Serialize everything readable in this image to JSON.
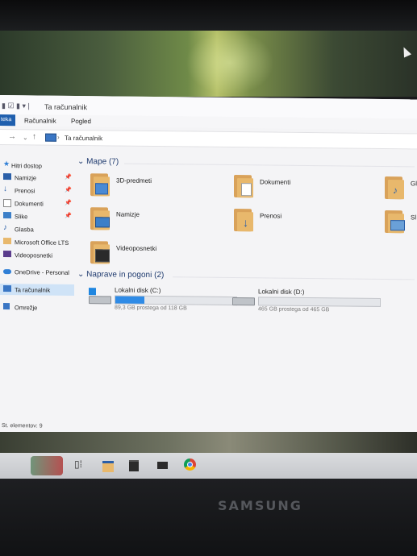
{
  "window": {
    "title": "Ta računalnik",
    "status": "St. elementov: 9"
  },
  "ribbon": {
    "file_tab": "teka",
    "tabs": [
      "Računalnik",
      "Pogled"
    ]
  },
  "address": {
    "path": "Ta računalnik"
  },
  "navpane": {
    "items": [
      {
        "label": "Hitri dostop",
        "icon": "star-icon",
        "pinned": false,
        "selected": false
      },
      {
        "label": "Namizje",
        "icon": "desktop-icon",
        "pinned": true,
        "selected": false
      },
      {
        "label": "Prenosi",
        "icon": "download-icon",
        "pinned": true,
        "selected": false
      },
      {
        "label": "Dokumenti",
        "icon": "document-icon",
        "pinned": true,
        "selected": false
      },
      {
        "label": "Slike",
        "icon": "pictures-icon",
        "pinned": true,
        "selected": false
      },
      {
        "label": "Glasba",
        "icon": "music-icon",
        "pinned": false,
        "selected": false
      },
      {
        "label": "Microsoft Office LTS",
        "icon": "folder-icon",
        "pinned": false,
        "selected": false
      },
      {
        "label": "Videoposnetki",
        "icon": "video-icon",
        "pinned": false,
        "selected": false
      },
      {
        "label": "OneDrive - Personal",
        "icon": "cloud-icon",
        "pinned": false,
        "selected": false
      },
      {
        "label": "Ta računalnik",
        "icon": "computer-icon",
        "pinned": false,
        "selected": true
      },
      {
        "label": "Omrežje",
        "icon": "network-icon",
        "pinned": false,
        "selected": false
      }
    ]
  },
  "folders": {
    "header": "Mape (7)",
    "items": [
      {
        "label": "3D-predmeti",
        "icon": "3d-objects-icon"
      },
      {
        "label": "Dokumenti",
        "icon": "documents-folder-icon"
      },
      {
        "label": "Gl",
        "icon": "music-folder-icon"
      },
      {
        "label": "Namizje",
        "icon": "desktop-folder-icon"
      },
      {
        "label": "Prenosi",
        "icon": "downloads-folder-icon"
      },
      {
        "label": "Sl",
        "icon": "pictures-folder-icon"
      },
      {
        "label": "Videoposnetki",
        "icon": "videos-folder-icon"
      }
    ]
  },
  "drives": {
    "header": "Naprave in pogoni (2)",
    "items": [
      {
        "label": "Lokalni disk (C:)",
        "free": "89,3 GB prostega od 118 GB",
        "used_fraction": 0.24,
        "icon": "windows-drive-icon"
      },
      {
        "label": "Lokalni disk (D:)",
        "free": "465 GB prostega od 465 GB",
        "used_fraction": 0.0,
        "icon": "hard-drive-icon"
      }
    ]
  },
  "taskbar": {
    "icons": [
      "task-view-icon",
      "file-explorer-icon",
      "store-icon",
      "mail-icon",
      "chrome-icon"
    ]
  },
  "device": {
    "brand": "SAMSUNG"
  },
  "colors": {
    "accent": "#1f5fae",
    "drive_fill": "#2f8be6",
    "folder": "#e8b86c",
    "selected": "#cfe3f7"
  }
}
